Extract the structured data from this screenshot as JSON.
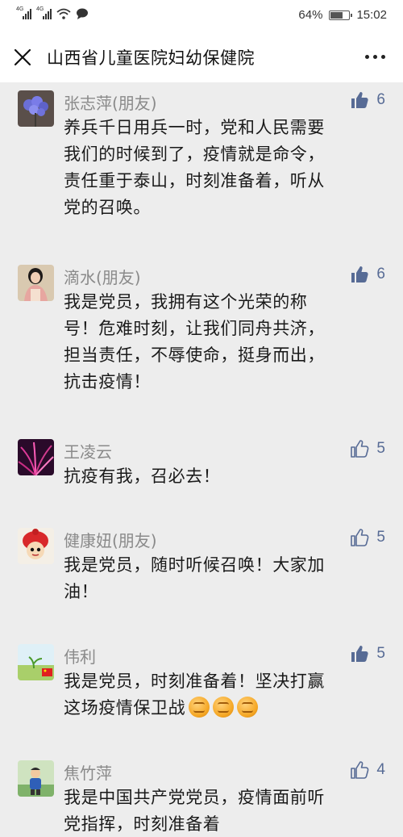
{
  "status_bar": {
    "signal1_tag": "4G",
    "signal2_tag": "4G",
    "battery_text": "64%",
    "time": "15:02"
  },
  "nav": {
    "title": "山西省儿童医院妇幼保健院"
  },
  "colors": {
    "link_blue": "#576b95",
    "name_gray": "#8a8a8a",
    "background": "#ededed"
  },
  "comments": [
    {
      "name": "张志萍(朋友)",
      "likes": "6",
      "liked": true,
      "avatar_icon": "purple-flower-photo",
      "text": [
        "养兵千日用兵一时，党和人民需要",
        "我们的时候到了，疫情就是命令，",
        "责任重于泰山，时刻准备着，听从",
        "党的召唤。"
      ]
    },
    {
      "name": "滴水(朋友)",
      "likes": "6",
      "liked": true,
      "avatar_icon": "woman-portrait-photo",
      "text": [
        "我是党员，我拥有这个光荣的称",
        "号！危难时刻，让我们同舟共济，",
        "担当责任，不辱使命，挺身而出，",
        "抗击疫情！"
      ]
    },
    {
      "name": "王凌云",
      "likes": "5",
      "liked": false,
      "avatar_icon": "pink-feather-photo",
      "text": [
        "抗疫有我，召必去！"
      ]
    },
    {
      "name": "健康妞(朋友)",
      "likes": "5",
      "liked": false,
      "avatar_icon": "red-hat-doll-photo",
      "text": [
        "我是党员，随时听候召唤！大家加",
        "油！"
      ]
    },
    {
      "name": "伟利",
      "likes": "5",
      "liked": true,
      "avatar_icon": "sprout-flag-photo",
      "text": [
        "我是党员，时刻准备着！坚决打赢",
        "这场疫情保卫战"
      ],
      "emoji_count": 3,
      "emoji_icon": "fist-emoji"
    },
    {
      "name": "焦竹萍",
      "likes": "4",
      "liked": false,
      "avatar_icon": "child-outdoor-photo",
      "text": [
        "我是中国共产党党员，疫情面前听",
        "党指挥，时刻准备着"
      ]
    }
  ]
}
